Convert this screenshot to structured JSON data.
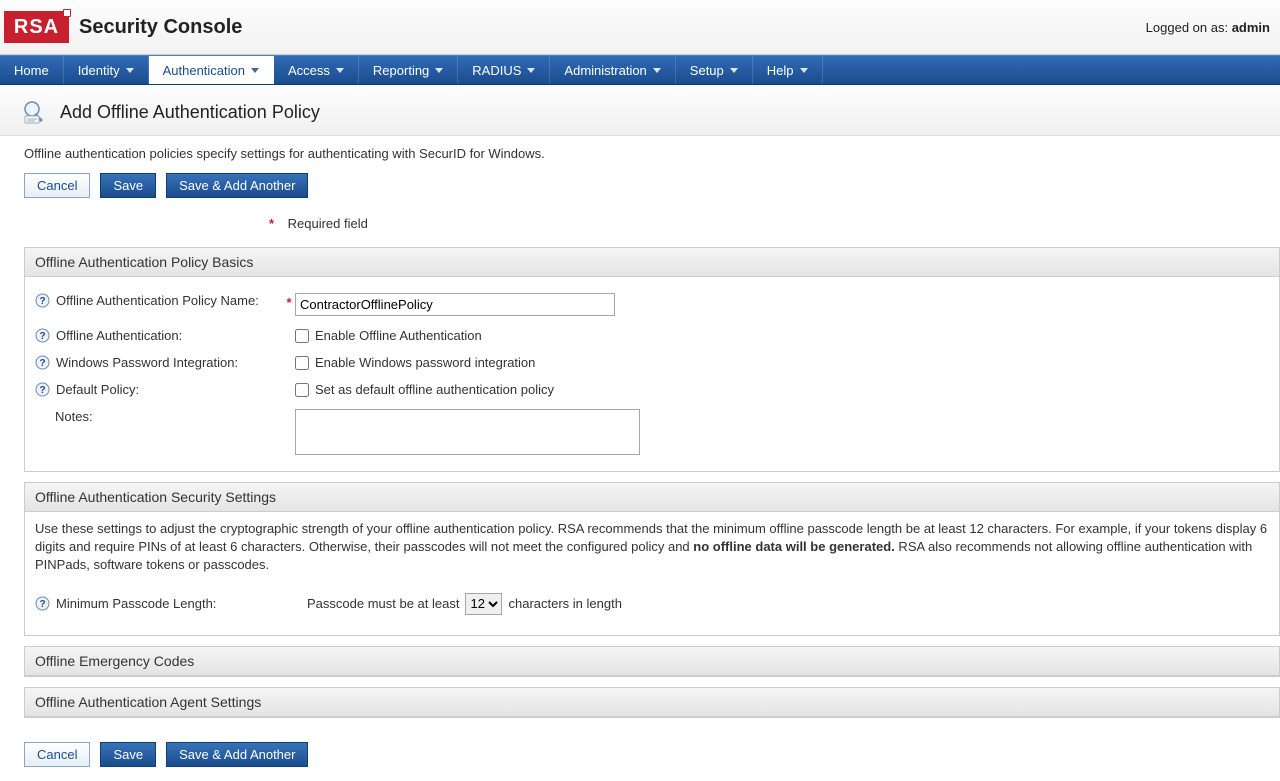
{
  "header": {
    "logo_text": "RSA",
    "console_title": "Security Console",
    "login_prefix": "Logged on as: ",
    "login_user": "admin"
  },
  "nav": {
    "items": [
      {
        "label": "Home",
        "dropdown": false
      },
      {
        "label": "Identity",
        "dropdown": true
      },
      {
        "label": "Authentication",
        "dropdown": true,
        "active": true
      },
      {
        "label": "Access",
        "dropdown": true
      },
      {
        "label": "Reporting",
        "dropdown": true
      },
      {
        "label": "RADIUS",
        "dropdown": true
      },
      {
        "label": "Administration",
        "dropdown": true
      },
      {
        "label": "Setup",
        "dropdown": true
      },
      {
        "label": "Help",
        "dropdown": true
      }
    ]
  },
  "page": {
    "title": "Add Offline Authentication Policy",
    "description": "Offline authentication policies specify settings for authenticating with SecurID for Windows.",
    "required_label": "Required field"
  },
  "buttons": {
    "cancel": "Cancel",
    "save": "Save",
    "save_add": "Save & Add Another"
  },
  "sections": {
    "basics": {
      "title": "Offline Authentication Policy Basics",
      "fields": {
        "name_label": "Offline Authentication Policy Name:",
        "name_value": "ContractorOfflinePolicy",
        "offline_auth_label": "Offline Authentication:",
        "offline_auth_cb": "Enable Offline Authentication",
        "win_pass_label": "Windows Password Integration:",
        "win_pass_cb": "Enable Windows password integration",
        "default_label": "Default Policy:",
        "default_cb": "Set as default offline authentication policy",
        "notes_label": "Notes:"
      }
    },
    "security": {
      "title": "Offline Authentication Security Settings",
      "text_a": "Use these settings to adjust the cryptographic strength of your offline authentication policy. RSA recommends that the minimum offline passcode length be at least 12 characters. For example, if your tokens display 6 digits and require PINs of at least 6 characters. Otherwise, their passcodes will not meet the configured policy and ",
      "text_bold": "no offline data will be generated.",
      "text_b": " RSA also recommends not allowing offline authentication with PINPads, software tokens or passcodes.",
      "min_pass_label": "Minimum Passcode Length:",
      "pass_prefix": "Passcode must be at least",
      "pass_value": "12",
      "pass_suffix": "characters in length"
    },
    "emergency": {
      "title": "Offline Emergency Codes"
    },
    "agent": {
      "title": "Offline Authentication Agent Settings"
    }
  }
}
